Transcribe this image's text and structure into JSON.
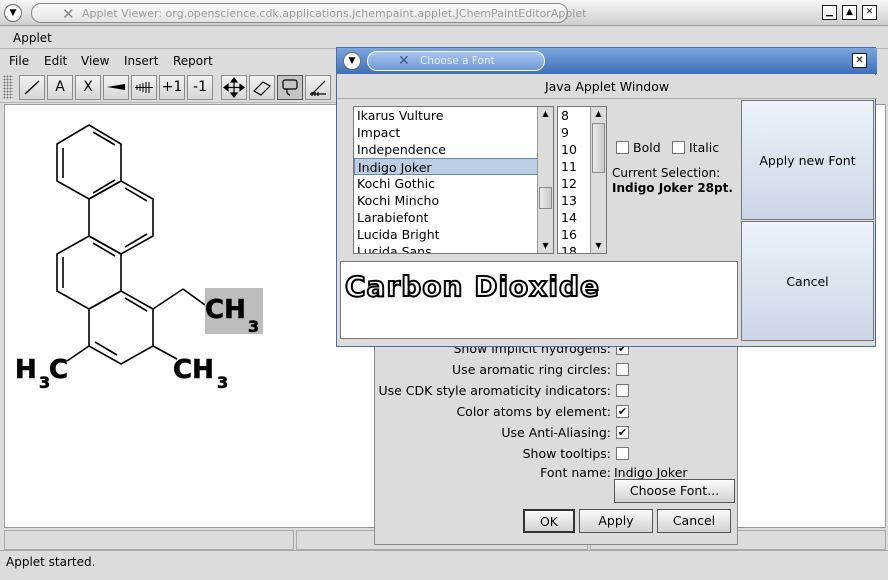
{
  "window": {
    "title": "Applet Viewer: org.openscience.cdk.applications.jchempaint.applet.JChemPaintEditorApplet",
    "applet_menu": "Applet"
  },
  "menubar": [
    "File",
    "Edit",
    "View",
    "Insert",
    "Report"
  ],
  "toolbar": {
    "tools": [
      {
        "label": "",
        "icon": "line-icon"
      },
      {
        "label": "A",
        "icon": "atom-label-icon"
      },
      {
        "label": "X",
        "icon": "element-symbol-icon"
      },
      {
        "label": "",
        "icon": "wedge-bond-icon"
      },
      {
        "label": "",
        "icon": "hash-bond-icon"
      },
      {
        "label": "+1",
        "icon": "increase-charge-icon"
      },
      {
        "label": "-1",
        "icon": "decrease-charge-icon"
      },
      {
        "label": "",
        "icon": "move-icon"
      },
      {
        "label": "",
        "icon": "eraser-icon"
      },
      {
        "label": "",
        "icon": "lasso-select-icon"
      },
      {
        "label": "",
        "icon": "cleanup-icon"
      }
    ]
  },
  "molecule": {
    "labels": {
      "ch3_right": "CH",
      "ch3_right_sub": "3",
      "ch3_lower": "CH",
      "ch3_lower_sub": "3",
      "h3c_left_h": "H",
      "h3c_left_sub": "3",
      "h3c_left_c": "C"
    }
  },
  "status": {
    "text": "Applet started."
  },
  "preferences": {
    "rows": [
      {
        "label": "Show implicit hydrogens:",
        "checked": true
      },
      {
        "label": "Use aromatic ring circles:",
        "checked": false
      },
      {
        "label": "Use CDK style aromaticity indicators:",
        "checked": false
      },
      {
        "label": "Color atoms by element:",
        "checked": true
      },
      {
        "label": "Use Anti-Aliasing:",
        "checked": true
      },
      {
        "label": "Show tooltips:",
        "checked": false
      }
    ],
    "font_name_label": "Font name:",
    "font_name_value": "Indigo Joker",
    "choose_font_button": "Choose Font...",
    "ok_button": "OK",
    "apply_button": "Apply",
    "cancel_button": "Cancel"
  },
  "font_dialog": {
    "title": "Choose a Font",
    "subtitle": "Java Applet Window",
    "fonts": [
      "Ikarus Vulture",
      "Impact",
      "Independence",
      "Indigo Joker",
      "Kochi Gothic",
      "Kochi Mincho",
      "Larabiefont",
      "Lucida Bright",
      "Lucida Sans"
    ],
    "selected_font_index": 3,
    "sizes": [
      "8",
      "9",
      "10",
      "11",
      "12",
      "13",
      "14",
      "16",
      "18"
    ],
    "bold_label": "Bold",
    "italic_label": "Italic",
    "bold_checked": false,
    "italic_checked": false,
    "current_selection_label": "Current Selection:",
    "current_selection_value": "Indigo Joker 28pt.",
    "apply_button": "Apply new Font",
    "cancel_button": "Cancel",
    "preview_text": "Carbon Dioxide"
  }
}
